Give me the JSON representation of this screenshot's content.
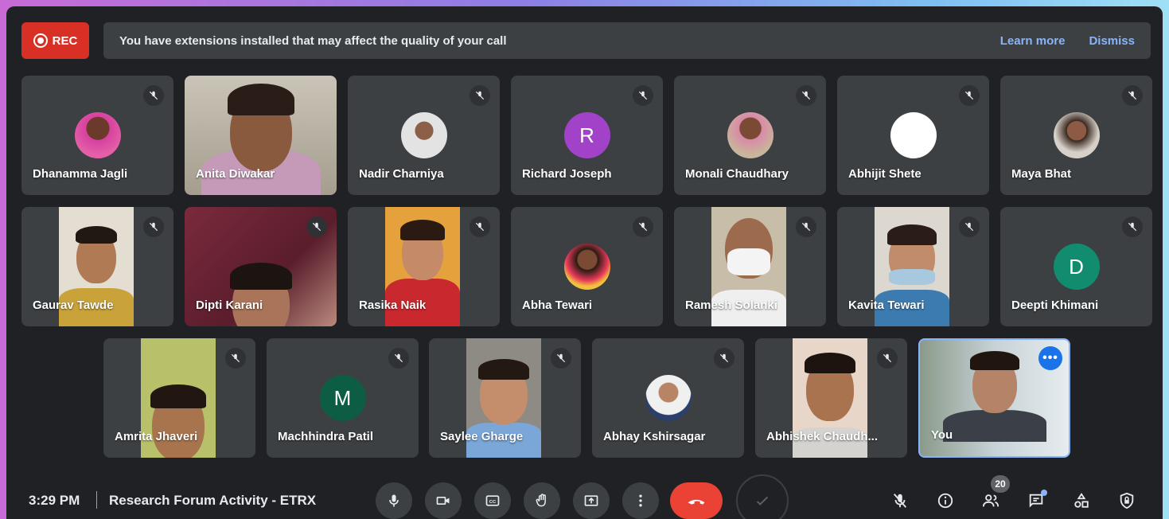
{
  "recording": {
    "label": "REC"
  },
  "banner": {
    "message": "You have extensions installed that may affect the quality of your call",
    "learn_more": "Learn more",
    "dismiss": "Dismiss"
  },
  "participants": {
    "row1": [
      "Dhanamma Jagli",
      "Anita Diwakar",
      "Nadir Charniya",
      "Richard Joseph",
      "Monali Chaudhary",
      "Abhijit Shete",
      "Maya Bhat"
    ],
    "row2": [
      "Gaurav Tawde",
      "Dipti Karani",
      "Rasika Naik",
      "Abha Tewari",
      "Ramesh Solanki",
      "Kavita Tewari",
      "Deepti Khimani"
    ],
    "row3": [
      "Amrita Jhaveri",
      "Machhindra Patil",
      "Saylee Gharge",
      "Abhay Kshirsagar",
      "Abhishek Chaudh...",
      "You"
    ]
  },
  "initials": {
    "richard": "R",
    "deepti": "D",
    "machhindra": "M"
  },
  "colors": {
    "richard": "#a142c9",
    "deepti": "#128c6e",
    "machhindra": "#0d5d44",
    "end_call": "#ea4335",
    "accent": "#8ab4f8"
  },
  "bottom_bar": {
    "time": "3:29 PM",
    "separator": "|",
    "meeting_title": "Research Forum Activity - ETRX",
    "participant_count": "20",
    "self_menu": "•••"
  },
  "icons": [
    "mic-icon",
    "camera-icon",
    "captions-icon",
    "raise-hand-icon",
    "present-icon",
    "more-options-icon",
    "end-call-icon",
    "check-icon",
    "mic-off-icon",
    "info-icon",
    "people-icon",
    "chat-icon",
    "activities-icon",
    "host-controls-icon"
  ]
}
